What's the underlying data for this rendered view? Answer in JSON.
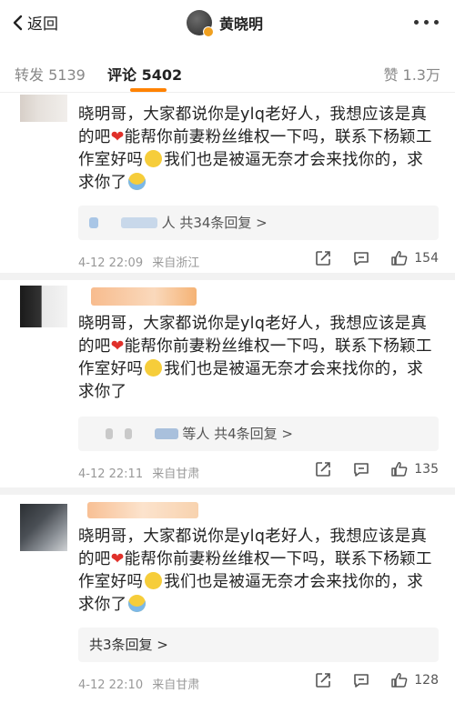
{
  "nav": {
    "back_label": "返回",
    "username": "黄晓明"
  },
  "tabs": {
    "repost": "转发 5139",
    "comment": "评论 5402",
    "like": "赞 1.3万"
  },
  "comments": [
    {
      "text_a": "晓明哥，大家都说你是ylq老好人，我想应该是真的吧",
      "text_b": "能帮你前妻粉丝维权一下吗，联系下杨颖工作室好吗",
      "text_c": "我们也是被逼无奈才会来找你的，求求你了",
      "replies": "人 共34条回复 >",
      "time": "4-12 22:09",
      "source": "来自浙江",
      "likes": "154"
    },
    {
      "text_a": "晓明哥，大家都说你是ylq老好人，我想应该是真的吧",
      "text_b": "能帮你前妻粉丝维权一下吗，联系下杨颖工作室好吗",
      "text_c": "我们也是被逼无奈才会来找你的，求求你了",
      "replies": "等人 共4条回复 >",
      "time": "4-12 22:11",
      "source": "来自甘肃",
      "likes": "135"
    },
    {
      "text_a": "晓明哥，大家都说你是ylq老好人，我想应该是真的吧",
      "text_b": "能帮你前妻粉丝维权一下吗，联系下杨颖工作室好吗",
      "text_c": "我们也是被逼无奈才会来找你的，求求你了",
      "replies": "共3条回复 >",
      "time": "4-12 22:10",
      "source": "来自甘肃",
      "likes": "128"
    }
  ],
  "icons": [
    "back-arrow-icon",
    "more-icon",
    "verified-badge-icon",
    "heart-emoji-icon",
    "eye-roll-emoji-icon",
    "crying-emoji-icon",
    "share-icon",
    "comment-icon",
    "like-icon"
  ],
  "colors": {
    "accent": "#ff8200",
    "heart": "#e0302a",
    "meta": "#999999"
  }
}
